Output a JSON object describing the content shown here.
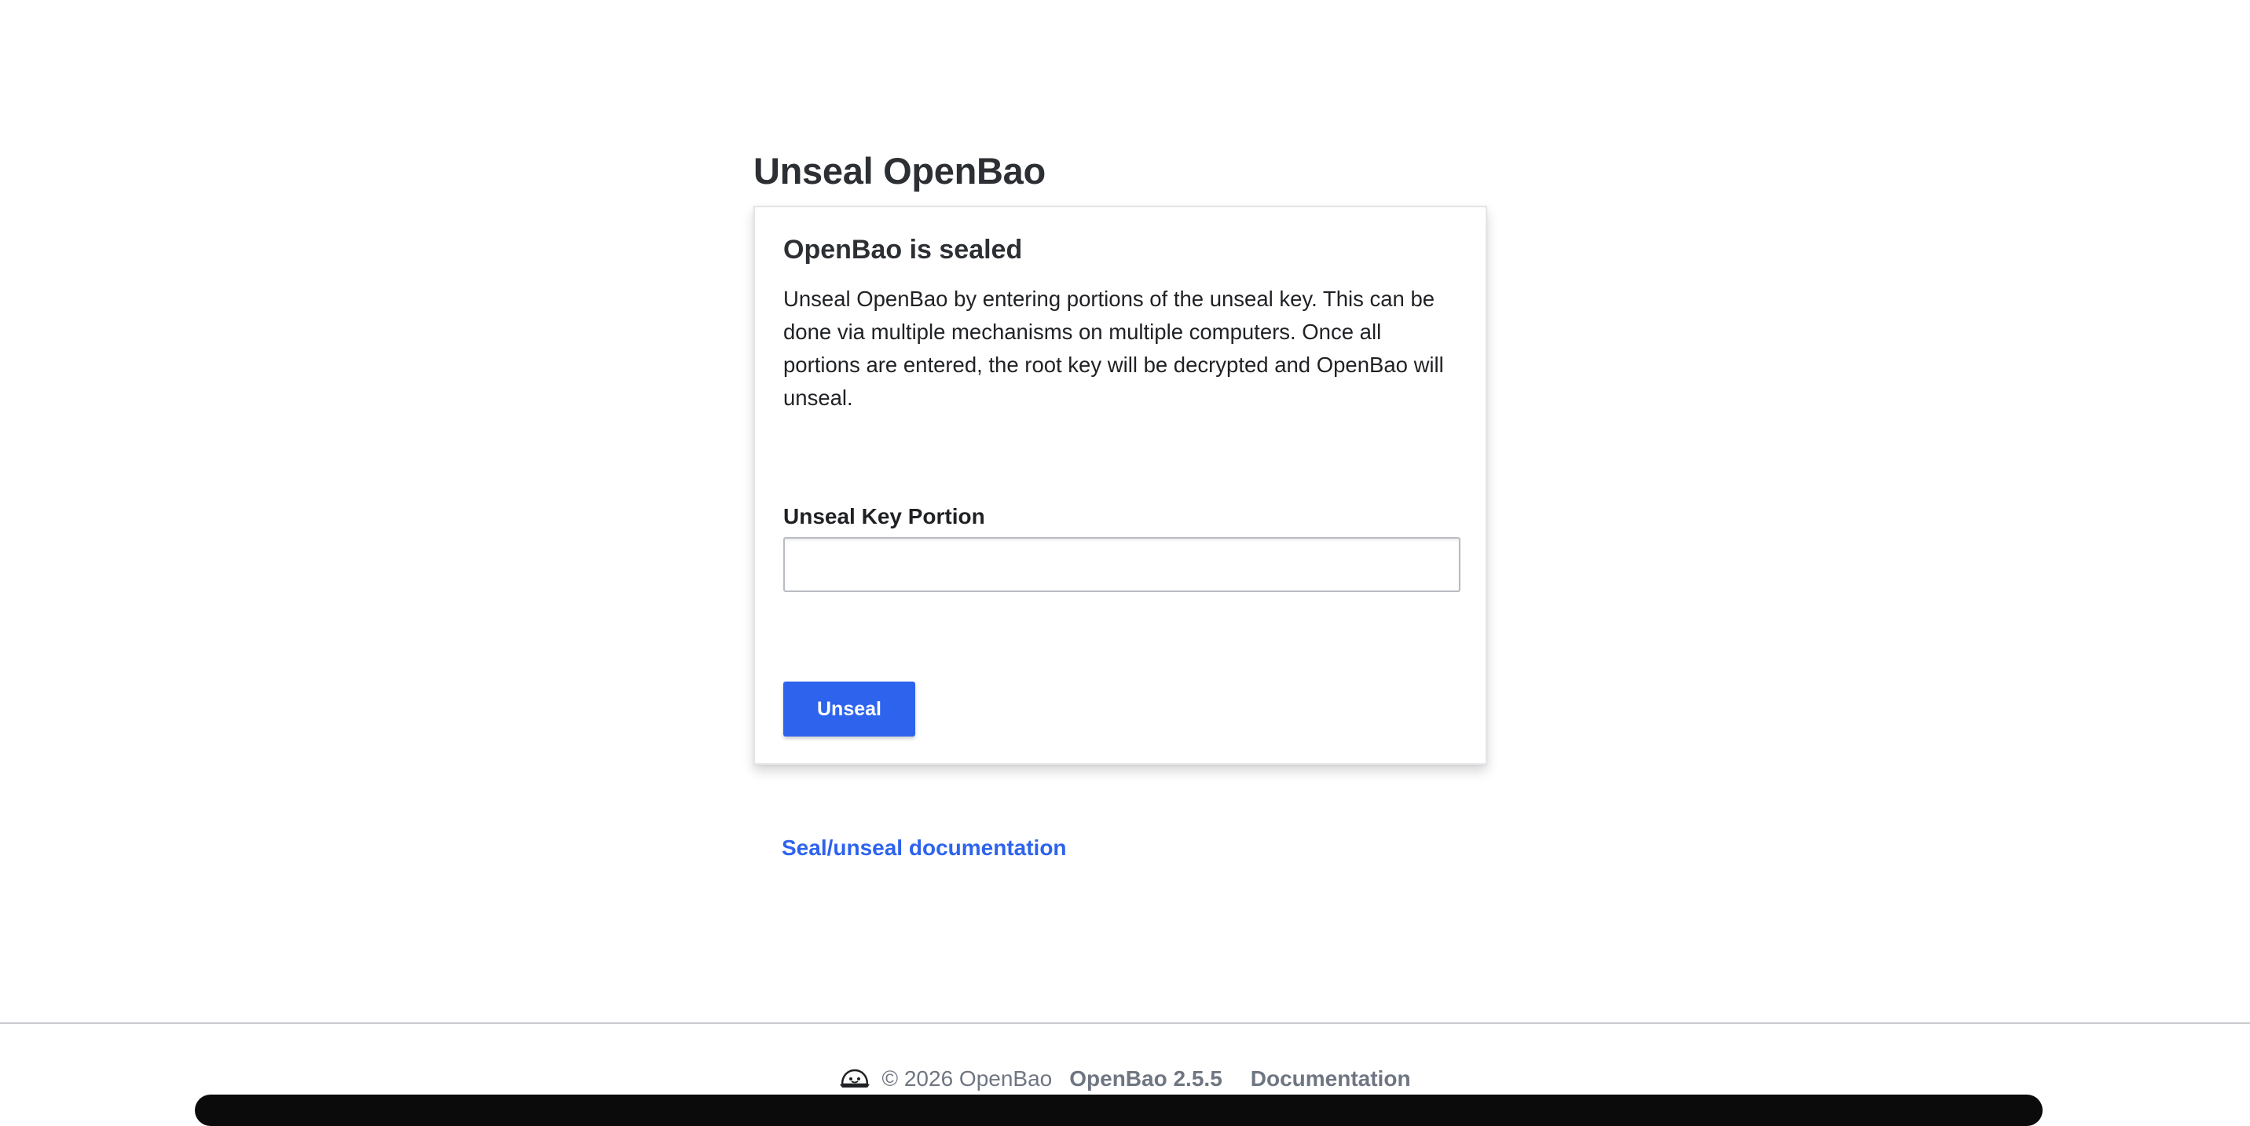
{
  "page": {
    "title": "Unseal OpenBao"
  },
  "card": {
    "title": "OpenBao is sealed",
    "description": "Unseal OpenBao by entering portions of the unseal key. This can be done via multiple mechanisms on multiple computers. Once all portions are entered, the root key will be decrypted and OpenBao will unseal.",
    "field_label": "Unseal Key Portion",
    "field_value": "",
    "button_label": "Unseal"
  },
  "links": {
    "documentation": "Seal/unseal documentation"
  },
  "footer": {
    "logo_icon": "openbao-logo-icon",
    "copyright": "© 2026 OpenBao",
    "version": "OpenBao 2.5.5",
    "documentation": "Documentation"
  },
  "colors": {
    "accent": "#2d63ed",
    "muted_text": "#6f7682"
  }
}
